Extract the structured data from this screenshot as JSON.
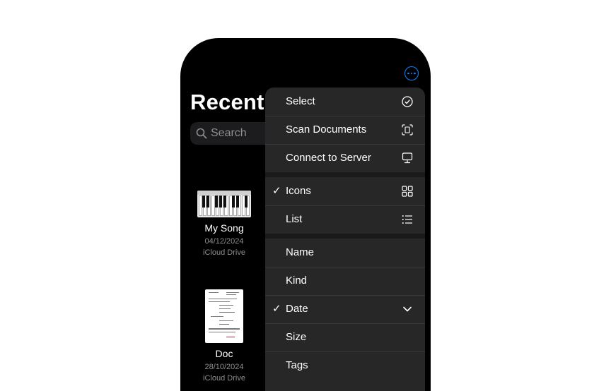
{
  "screen": {
    "title": "Recents"
  },
  "search": {
    "placeholder": "Search"
  },
  "files": [
    {
      "name": "My Song",
      "date": "04/12/2024",
      "location": "iCloud Drive",
      "icon": "piano-thumbnail-icon"
    },
    {
      "name": "Doc",
      "date": "28/10/2024",
      "location": "iCloud Drive",
      "icon": "document-thumbnail-icon"
    }
  ],
  "menu": {
    "actions": [
      {
        "label": "Select",
        "icon": "checkmark-circle-icon"
      },
      {
        "label": "Scan Documents",
        "icon": "scan-document-icon"
      },
      {
        "label": "Connect to Server",
        "icon": "server-display-icon"
      }
    ],
    "view_options": [
      {
        "label": "Icons",
        "checked": true,
        "icon": "grid-icon"
      },
      {
        "label": "List",
        "checked": false,
        "icon": "list-icon"
      }
    ],
    "sort_options": [
      {
        "label": "Name",
        "checked": false
      },
      {
        "label": "Kind",
        "checked": false
      },
      {
        "label": "Date",
        "checked": true,
        "icon": "chevron-down-icon"
      },
      {
        "label": "Size",
        "checked": false
      },
      {
        "label": "Tags",
        "checked": false
      }
    ],
    "check_glyph": "✓"
  },
  "colors": {
    "accent": "#0a84ff",
    "background": "#000000",
    "menu": "#272727"
  }
}
